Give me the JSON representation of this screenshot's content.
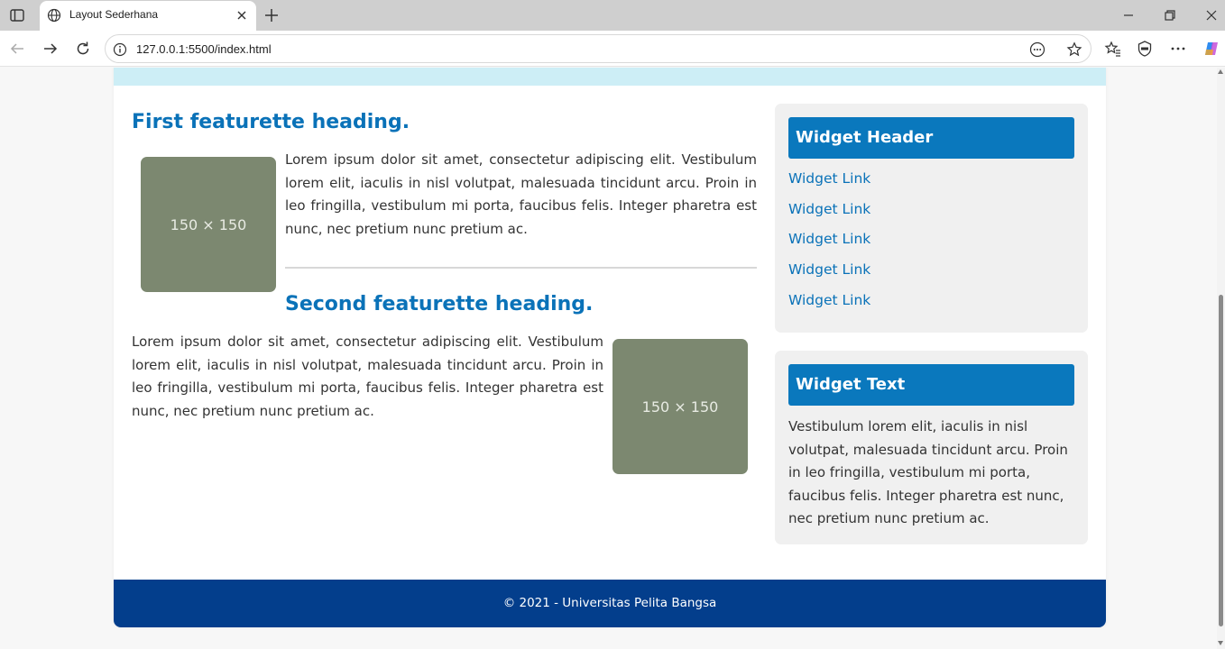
{
  "browser": {
    "tab_title": "Layout Sederhana",
    "url": "127.0.0.1:5500/index.html"
  },
  "main": {
    "featurette1": {
      "heading": "First featurette heading.",
      "image_label": "150 × 150",
      "text": "Lorem ipsum dolor sit amet, consectetur adipiscing elit. Vestibulum lorem elit, iaculis in nisl volutpat, malesuada tincidunt arcu. Proin in leo fringilla, vestibulum mi porta, faucibus felis. Integer pharetra est nunc, nec pretium nunc pretium ac."
    },
    "featurette2": {
      "heading": "Second featurette heading.",
      "image_label": "150 × 150",
      "text": "Lorem ipsum dolor sit amet, consectetur adipiscing elit. Vestibulum lorem elit, iaculis in nisl volutpat, malesuada tincidunt arcu. Proin in leo fringilla, vestibulum mi porta, faucibus felis. Integer pharetra est nunc, nec pretium nunc pretium ac."
    }
  },
  "sidebar": {
    "widget1": {
      "header": "Widget Header",
      "links": [
        "Widget Link",
        "Widget Link",
        "Widget Link",
        "Widget Link",
        "Widget Link"
      ]
    },
    "widget2": {
      "header": "Widget Text",
      "text": "Vestibulum lorem elit, iaculis in nisl volutpat, malesuada tincidunt arcu. Proin in leo fringilla, vestibulum mi porta, faucibus felis. Integer pharetra est nunc, nec pretium nunc pretium ac."
    }
  },
  "footer": {
    "text": "© 2021 - Universitas Pelita Bangsa"
  },
  "colors": {
    "accent": "#0a72b8",
    "footer": "#033e8c",
    "nav_strip": "#cdeef6",
    "placeholder": "#7c8870"
  }
}
